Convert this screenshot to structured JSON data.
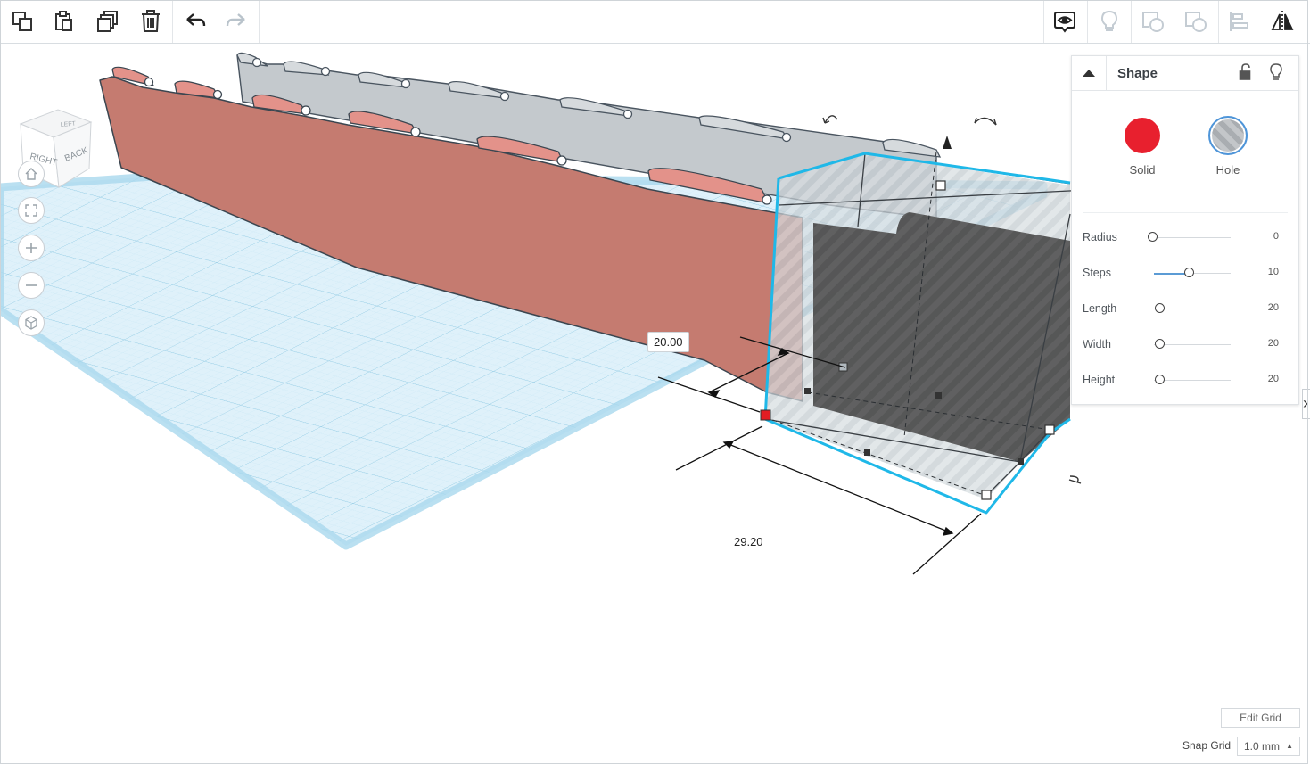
{
  "toolbar": {
    "left_icons": [
      "copy-icon",
      "paste-icon",
      "duplicate-icon",
      "delete-icon",
      "undo-icon",
      "redo-icon"
    ],
    "right_icons": [
      "show-all-icon",
      "light-bulb-icon",
      "group-icon",
      "ungroup-icon",
      "align-icon",
      "mirror-icon"
    ]
  },
  "view_cube": {
    "faces": [
      "RIGHT",
      "BACK",
      "LEFT"
    ]
  },
  "view_controls": [
    "home-view-icon",
    "fit-view-icon",
    "zoom-in-icon",
    "zoom-out-icon",
    "perspective-icon"
  ],
  "dimensions": {
    "width_label": "20.00",
    "length_label": "29.20"
  },
  "inspector": {
    "title": "Shape",
    "solid_label": "Solid",
    "hole_label": "Hole",
    "properties": [
      {
        "label": "Radius",
        "value": "0",
        "fraction": 0.0
      },
      {
        "label": "Steps",
        "value": "10",
        "fraction": 0.46
      },
      {
        "label": "Length",
        "value": "20",
        "fraction": 0.08
      },
      {
        "label": "Width",
        "value": "20",
        "fraction": 0.08
      },
      {
        "label": "Height",
        "value": "20",
        "fraction": 0.08
      }
    ],
    "colors": {
      "solid": "#e8202e",
      "hole": "#b8bbbe"
    }
  },
  "footer": {
    "edit_grid_label": "Edit Grid",
    "snap_grid_label": "Snap Grid",
    "snap_grid_value": "1.0 mm"
  },
  "scene_colors": {
    "workplane": "#a9d8ee",
    "red_part": "#c57b70",
    "gray_part": "#c4c9cd",
    "selection": "#1fb8e8"
  }
}
